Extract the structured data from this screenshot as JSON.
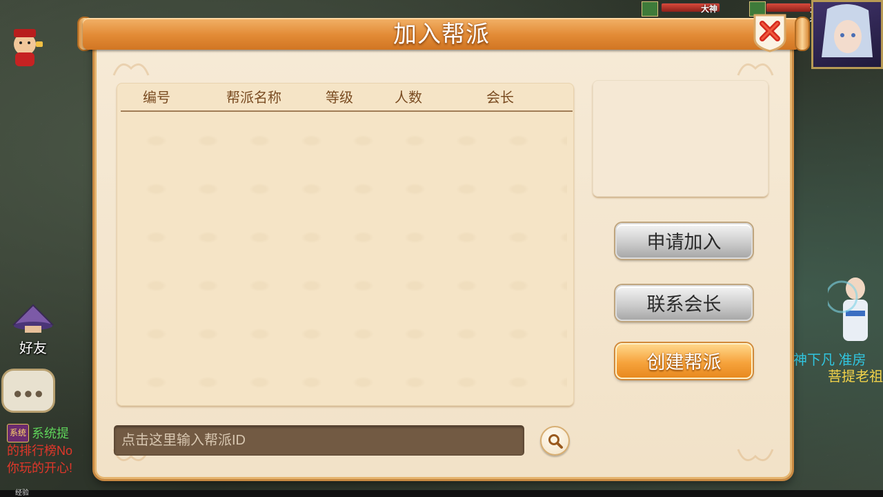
{
  "dialog": {
    "title": "加入帮派",
    "columns": [
      "编号",
      "帮派名称",
      "等级",
      "人数",
      "会长"
    ],
    "rows": [],
    "buttons": {
      "apply": "申请加入",
      "contact": "联系会长",
      "create": "创建帮派"
    },
    "search": {
      "placeholder": "点击这里输入帮派ID",
      "value": ""
    }
  },
  "hud": {
    "friends_label": "好友",
    "player_tags": [
      "大神",
      "大神"
    ],
    "exp_label": "经验",
    "chat": {
      "system_tag": "系统",
      "line1": "系统提",
      "line2": "的排行榜No",
      "line3": "你玩的开心!"
    },
    "scene_text": {
      "line1": "神下凡   准房",
      "line2": "菩提老祖"
    }
  },
  "colors": {
    "title_bar": "#e28a35",
    "panel_bg": "#f5e4c6",
    "dialog_bg": "#f6ead6",
    "button_gray": "#c9c9c9",
    "button_orange": "#f6a33c",
    "search_bg": "#725a43",
    "header_text": "#7a4c22"
  },
  "icons": {
    "close": "close-icon",
    "search": "search-icon",
    "friends": "hat-icon",
    "chat": "chat-bubble-icon"
  }
}
